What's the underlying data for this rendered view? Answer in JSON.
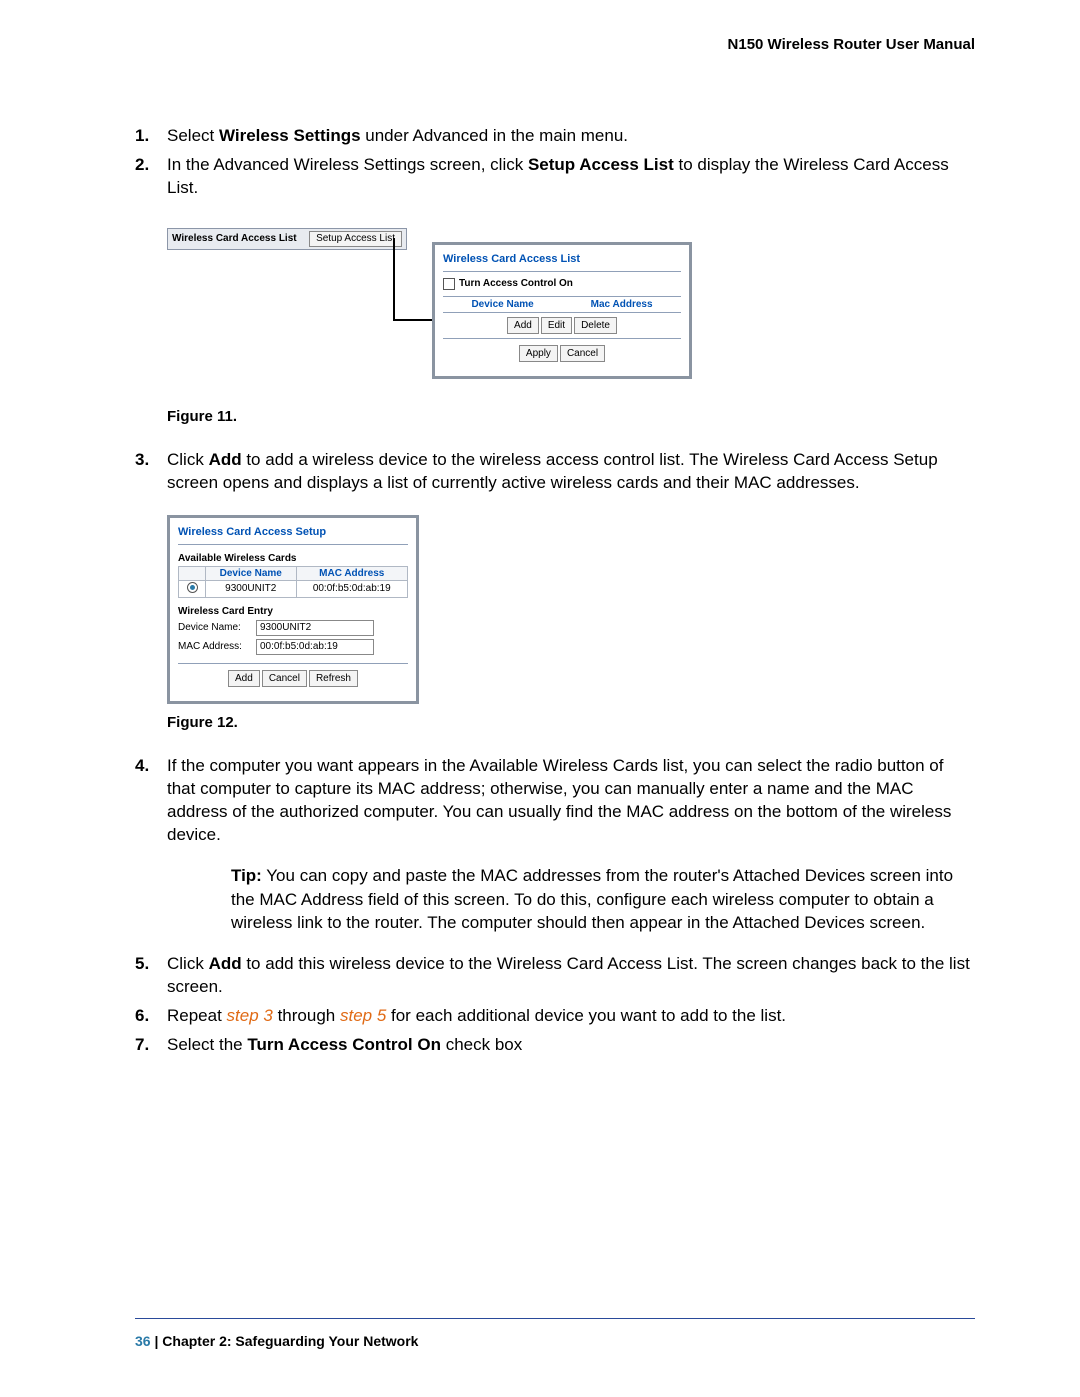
{
  "header": {
    "title": "N150 Wireless Router User Manual"
  },
  "steps": {
    "s1": {
      "num": "1.",
      "t1": "Select ",
      "b1": "Wireless Settings",
      "t2": " under Advanced in the main menu."
    },
    "s2": {
      "num": "2.",
      "t1": "In the Advanced Wireless Settings screen, click ",
      "b1": "Setup Access List",
      "t2": " to display the Wireless Card Access List."
    },
    "s3": {
      "num": "3.",
      "t1": "Click ",
      "b1": "Add",
      "t2": " to add a wireless device to the wireless access control list. The Wireless Card Access Setup screen opens and displays a list of currently active wireless cards and their MAC addresses."
    },
    "s4": {
      "num": "4.",
      "t1": "If the computer you want appears in the Available Wireless Cards list, you can select the radio button of that computer to capture its MAC address; otherwise, you can manually enter a name and the MAC address of the authorized computer. You can usually find the MAC address on the bottom of the wireless device."
    },
    "tip": {
      "label": "Tip:",
      "text": "You can copy and paste the MAC addresses from the router's Attached Devices screen into the MAC Address field of this screen. To do this, configure each wireless computer to obtain a wireless link to the router. The computer should then appear in the Attached Devices screen."
    },
    "s5": {
      "num": "5.",
      "t1": "Click ",
      "b1": "Add",
      "t2": " to add this wireless device to the Wireless Card Access List. The screen changes back to the list screen."
    },
    "s6": {
      "num": "6.",
      "t1": "Repeat ",
      "l1": "step 3",
      "t2": " through ",
      "l2": "step 5",
      "t3": " for each additional device you want to add to the list."
    },
    "s7": {
      "num": "7.",
      "t1": "Select the ",
      "b1": "Turn Access Control On",
      "t2": " check box"
    }
  },
  "figures": {
    "f11": "Figure 11.",
    "f12": "Figure 12."
  },
  "fig11": {
    "left_label": "Wireless Card Access List",
    "left_button": "Setup Access List",
    "panel_title": "Wireless Card Access List",
    "checkbox_label": "Turn Access Control On",
    "col_device": "Device Name",
    "col_mac": "Mac Address",
    "btn_add": "Add",
    "btn_edit": "Edit",
    "btn_delete": "Delete",
    "btn_apply": "Apply",
    "btn_cancel": "Cancel"
  },
  "fig12": {
    "panel_title": "Wireless Card Access Setup",
    "avail_label": "Available Wireless Cards",
    "col_device": "Device Name",
    "col_mac": "MAC Address",
    "row_device": "9300UNIT2",
    "row_mac": "00:0f:b5:0d:ab:19",
    "entry_label": "Wireless Card Entry",
    "dev_label": "Device Name:",
    "dev_value": "9300UNIT2",
    "mac_label": "MAC Address:",
    "mac_value": "00:0f:b5:0d:ab:19",
    "btn_add": "Add",
    "btn_cancel": "Cancel",
    "btn_refresh": "Refresh"
  },
  "footer": {
    "page": "36",
    "sep": "   |   ",
    "chapter": "Chapter 2:  Safeguarding Your Network"
  }
}
